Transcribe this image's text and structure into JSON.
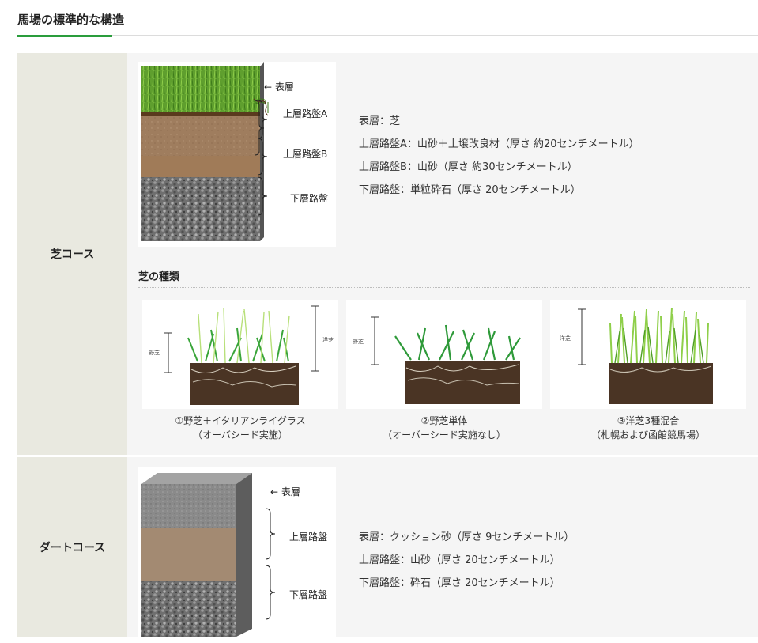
{
  "page": {
    "title": "馬場の標準的な構造"
  },
  "colors": {
    "accent": "#2a9d3c",
    "label_bg": "#e9e9e0",
    "content_bg": "#f5f5f5"
  },
  "turf": {
    "row_label": "芝コース",
    "diagram_labels": [
      "← 表層",
      "上層路盤A",
      "上層路盤B",
      "下層路盤"
    ],
    "specs": [
      "表層：芝",
      "上層路盤A：山砂＋土壌改良材（厚さ 約20センチメートル）",
      "上層路盤B：山砂（厚さ 約30センチメートル）",
      "下層路盤：単粒砕石（厚さ 20センチメートル）"
    ],
    "grass_section_title": "芝の種類",
    "grass_types": [
      {
        "caption_line1": "①野芝＋イタリアンライグラス",
        "caption_line2": "（オーバシード実施）",
        "tiny_left": "野芝",
        "tiny_right": "洋芝"
      },
      {
        "caption_line1": "②野芝単体",
        "caption_line2": "（オーバーシード実施なし）",
        "tiny_left": "野芝"
      },
      {
        "caption_line1": "③洋芝3種混合",
        "caption_line2": "（札幌および函館競馬場）",
        "tiny_left": "洋芝"
      }
    ]
  },
  "dirt": {
    "row_label": "ダートコース",
    "diagram_labels": [
      "← 表層",
      "上層路盤",
      "下層路盤"
    ],
    "specs": [
      "表層：クッション砂（厚さ 9センチメートル）",
      "上層路盤：山砂（厚さ 20センチメートル）",
      "下層路盤：砕石（厚さ 20センチメートル）"
    ]
  }
}
